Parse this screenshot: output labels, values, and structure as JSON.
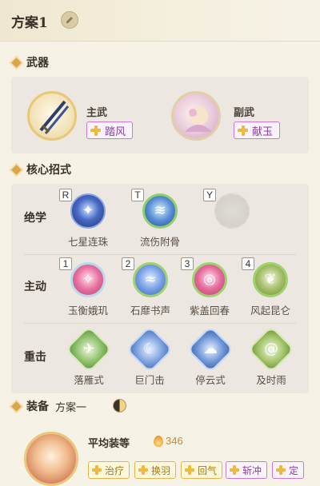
{
  "header": {
    "title": "方案1",
    "edit_icon": "edit-icon"
  },
  "weapons": {
    "section_title": "武器",
    "main": {
      "label": "主武",
      "tag": "踏风"
    },
    "sub": {
      "label": "副武",
      "tag": "献玉"
    }
  },
  "skills": {
    "section_title": "核心招式",
    "ultimate": {
      "label": "绝学",
      "items": [
        {
          "key": "R",
          "name": "七星连珠"
        },
        {
          "key": "T",
          "name": "流伤附骨"
        },
        {
          "key": "Y",
          "name": ""
        }
      ]
    },
    "active": {
      "label": "主动",
      "items": [
        {
          "key": "1",
          "name": "玉衡娥玑"
        },
        {
          "key": "2",
          "name": "石靡书声"
        },
        {
          "key": "3",
          "name": "紫盖回春"
        },
        {
          "key": "4",
          "name": "风起昆仑"
        }
      ]
    },
    "heavy": {
      "label": "重击",
      "items": [
        {
          "name": "落雁式"
        },
        {
          "name": "巨门击"
        },
        {
          "name": "停云式"
        },
        {
          "name": "及时雨"
        }
      ]
    }
  },
  "equipment": {
    "section_title": "装备",
    "plan_name": "方案一",
    "avg_label": "平均装等",
    "avg_value": "346",
    "stats": [
      "治疗",
      "换羽",
      "回气",
      "斩冲",
      "定"
    ]
  }
}
